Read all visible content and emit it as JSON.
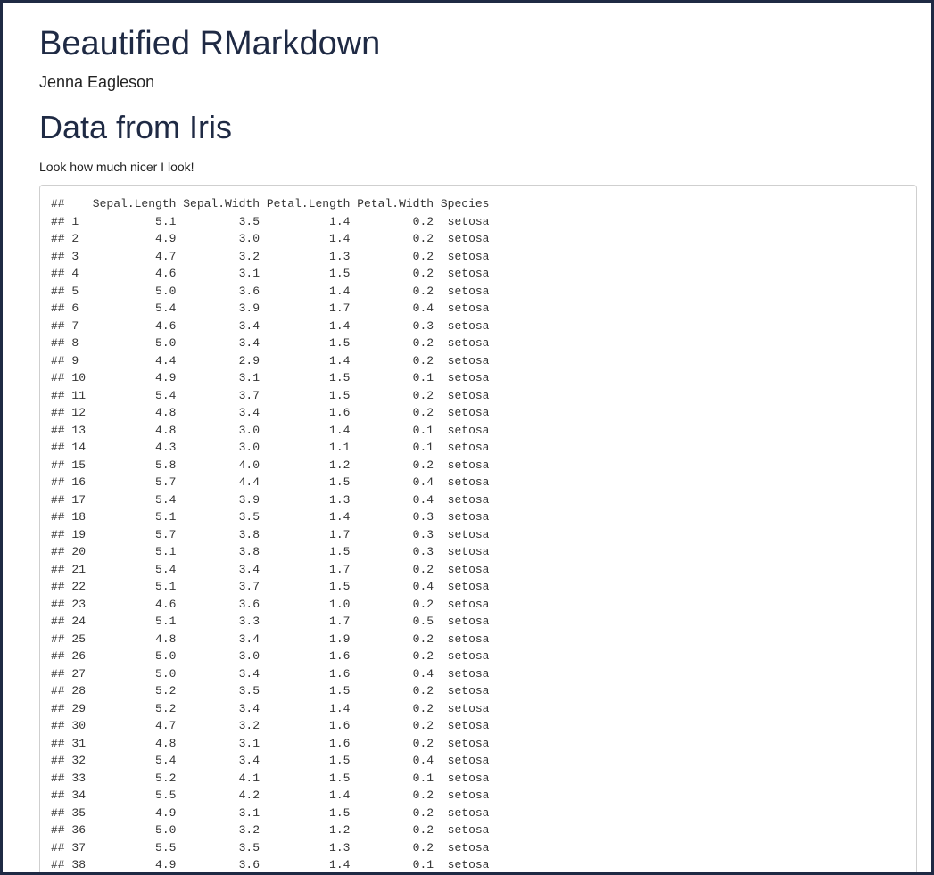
{
  "document": {
    "title": "Beautified RMarkdown",
    "author": "Jenna Eagleson"
  },
  "section": {
    "heading": "Data from Iris",
    "text": "Look how much nicer I look!"
  },
  "output": {
    "prefix": "##",
    "columns": [
      "Sepal.Length",
      "Sepal.Width",
      "Petal.Length",
      "Petal.Width",
      "Species"
    ],
    "rows": [
      [
        "1",
        "5.1",
        "3.5",
        "1.4",
        "0.2",
        "setosa"
      ],
      [
        "2",
        "4.9",
        "3.0",
        "1.4",
        "0.2",
        "setosa"
      ],
      [
        "3",
        "4.7",
        "3.2",
        "1.3",
        "0.2",
        "setosa"
      ],
      [
        "4",
        "4.6",
        "3.1",
        "1.5",
        "0.2",
        "setosa"
      ],
      [
        "5",
        "5.0",
        "3.6",
        "1.4",
        "0.2",
        "setosa"
      ],
      [
        "6",
        "5.4",
        "3.9",
        "1.7",
        "0.4",
        "setosa"
      ],
      [
        "7",
        "4.6",
        "3.4",
        "1.4",
        "0.3",
        "setosa"
      ],
      [
        "8",
        "5.0",
        "3.4",
        "1.5",
        "0.2",
        "setosa"
      ],
      [
        "9",
        "4.4",
        "2.9",
        "1.4",
        "0.2",
        "setosa"
      ],
      [
        "10",
        "4.9",
        "3.1",
        "1.5",
        "0.1",
        "setosa"
      ],
      [
        "11",
        "5.4",
        "3.7",
        "1.5",
        "0.2",
        "setosa"
      ],
      [
        "12",
        "4.8",
        "3.4",
        "1.6",
        "0.2",
        "setosa"
      ],
      [
        "13",
        "4.8",
        "3.0",
        "1.4",
        "0.1",
        "setosa"
      ],
      [
        "14",
        "4.3",
        "3.0",
        "1.1",
        "0.1",
        "setosa"
      ],
      [
        "15",
        "5.8",
        "4.0",
        "1.2",
        "0.2",
        "setosa"
      ],
      [
        "16",
        "5.7",
        "4.4",
        "1.5",
        "0.4",
        "setosa"
      ],
      [
        "17",
        "5.4",
        "3.9",
        "1.3",
        "0.4",
        "setosa"
      ],
      [
        "18",
        "5.1",
        "3.5",
        "1.4",
        "0.3",
        "setosa"
      ],
      [
        "19",
        "5.7",
        "3.8",
        "1.7",
        "0.3",
        "setosa"
      ],
      [
        "20",
        "5.1",
        "3.8",
        "1.5",
        "0.3",
        "setosa"
      ],
      [
        "21",
        "5.4",
        "3.4",
        "1.7",
        "0.2",
        "setosa"
      ],
      [
        "22",
        "5.1",
        "3.7",
        "1.5",
        "0.4",
        "setosa"
      ],
      [
        "23",
        "4.6",
        "3.6",
        "1.0",
        "0.2",
        "setosa"
      ],
      [
        "24",
        "5.1",
        "3.3",
        "1.7",
        "0.5",
        "setosa"
      ],
      [
        "25",
        "4.8",
        "3.4",
        "1.9",
        "0.2",
        "setosa"
      ],
      [
        "26",
        "5.0",
        "3.0",
        "1.6",
        "0.2",
        "setosa"
      ],
      [
        "27",
        "5.0",
        "3.4",
        "1.6",
        "0.4",
        "setosa"
      ],
      [
        "28",
        "5.2",
        "3.5",
        "1.5",
        "0.2",
        "setosa"
      ],
      [
        "29",
        "5.2",
        "3.4",
        "1.4",
        "0.2",
        "setosa"
      ],
      [
        "30",
        "4.7",
        "3.2",
        "1.6",
        "0.2",
        "setosa"
      ],
      [
        "31",
        "4.8",
        "3.1",
        "1.6",
        "0.2",
        "setosa"
      ],
      [
        "32",
        "5.4",
        "3.4",
        "1.5",
        "0.4",
        "setosa"
      ],
      [
        "33",
        "5.2",
        "4.1",
        "1.5",
        "0.1",
        "setosa"
      ],
      [
        "34",
        "5.5",
        "4.2",
        "1.4",
        "0.2",
        "setosa"
      ],
      [
        "35",
        "4.9",
        "3.1",
        "1.5",
        "0.2",
        "setosa"
      ],
      [
        "36",
        "5.0",
        "3.2",
        "1.2",
        "0.2",
        "setosa"
      ],
      [
        "37",
        "5.5",
        "3.5",
        "1.3",
        "0.2",
        "setosa"
      ],
      [
        "38",
        "4.9",
        "3.6",
        "1.4",
        "0.1",
        "setosa"
      ]
    ]
  }
}
